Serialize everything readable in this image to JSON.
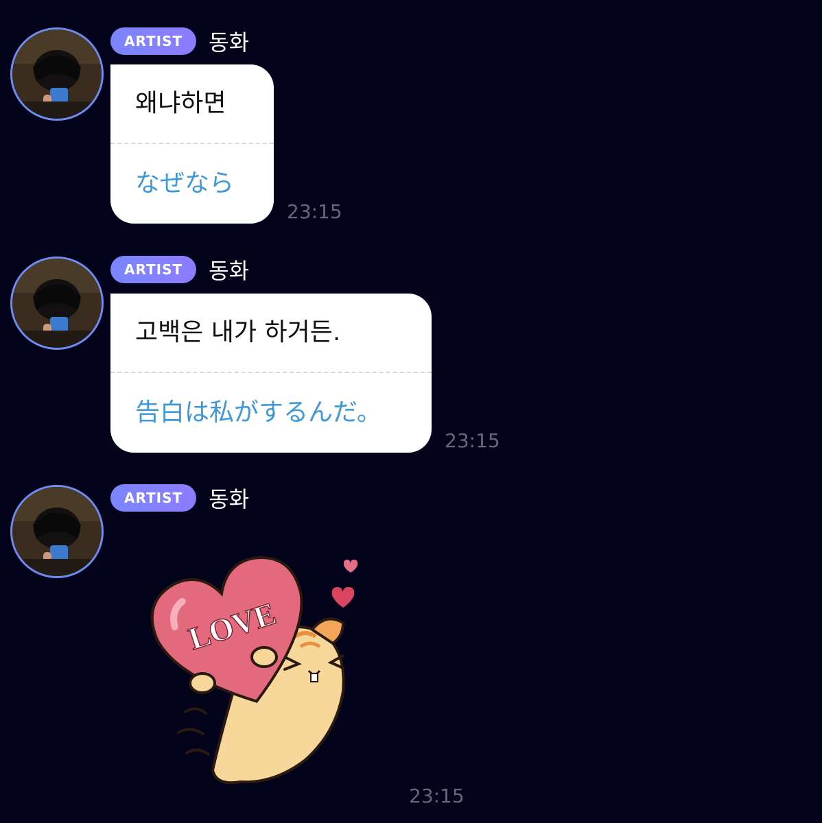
{
  "messages": [
    {
      "badge": "ARTIST",
      "sender": "동화",
      "text_ko": "왜냐하면",
      "text_ja": "なぜなら",
      "time": "23:15"
    },
    {
      "badge": "ARTIST",
      "sender": "동화",
      "text_ko": "고백은 내가 하거든.",
      "text_ja": "告白は私がするんだ。",
      "time": "23:15"
    },
    {
      "badge": "ARTIST",
      "sender": "동화",
      "sticker": {
        "text": "LOVE",
        "icon": "hamster-love-heart-sticker"
      },
      "time": "23:15"
    }
  ],
  "colors": {
    "background": "#03031c",
    "badge": "#7a86ff",
    "translation_text": "#3f98d8",
    "timestamp": "#66677a",
    "avatar_ring": "#6f8cf0"
  }
}
